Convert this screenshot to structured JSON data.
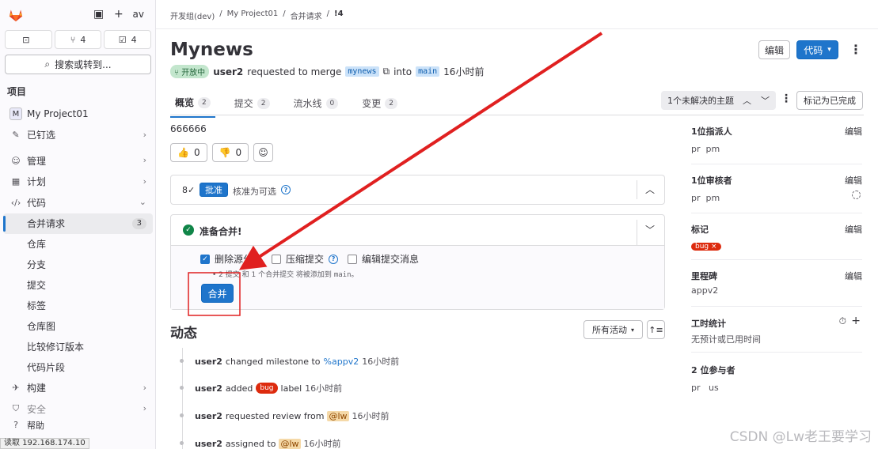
{
  "sidebar": {
    "avatar_text": "av",
    "counts": [
      {
        "icon": "issues-icon",
        "value": ""
      },
      {
        "icon": "merge-request-icon",
        "value": "4"
      },
      {
        "icon": "todo-icon",
        "value": "4"
      }
    ],
    "search_label": "搜索或转到...",
    "section_title": "项目",
    "project": {
      "initial": "M",
      "name": "My Project01"
    },
    "nav": {
      "pinned": "已钉选",
      "manage": "管理",
      "plan": "计划",
      "code": "代码",
      "code_sub": [
        {
          "label": "合并请求",
          "badge": "3"
        },
        {
          "label": "仓库"
        },
        {
          "label": "分支"
        },
        {
          "label": "提交"
        },
        {
          "label": "标签"
        },
        {
          "label": "仓库图"
        },
        {
          "label": "比较修订版本"
        },
        {
          "label": "代码片段"
        }
      ],
      "build": "构建",
      "secure": "安全",
      "help": "帮助"
    }
  },
  "statusbar": {
    "text": "读取 192.168.174.10"
  },
  "breadcrumb": [
    "开发组(dev)",
    "My Project01",
    "合并请求",
    "!4"
  ],
  "header": {
    "title": "Mynews",
    "edit_label": "编辑",
    "code_label": "代码"
  },
  "meta": {
    "state": "开放中",
    "author": "user2",
    "requested": "requested to merge",
    "source_branch": "mynews",
    "into": "into",
    "target_branch": "main",
    "time": "16小时前"
  },
  "tabs": [
    {
      "label": "概览",
      "count": "2"
    },
    {
      "label": "提交",
      "count": "2"
    },
    {
      "label": "流水线",
      "count": "0"
    },
    {
      "label": "变更",
      "count": "2"
    }
  ],
  "threads": {
    "label": "1个未解决的主题",
    "mark_done": "标记为已完成"
  },
  "description": "666666",
  "reactions": {
    "thumbs_up": "0",
    "thumbs_down": "0"
  },
  "approval": {
    "count": "8",
    "approve_label": "批准",
    "optional_text": "核准为可选"
  },
  "merge": {
    "title": "准备合并!",
    "delete_branch": "删除源分支",
    "squash": "压缩提交",
    "edit_message": "编辑提交消息",
    "summary_pre": "• 2 提交 和 1 个合并提交 将被添加到",
    "summary_branch": "main。",
    "merge_button": "合并"
  },
  "activity": {
    "title": "动态",
    "filter": "所有活动",
    "items": [
      {
        "user": "user2",
        "text": "changed milestone to",
        "target": "%appv2",
        "time": "16小时前"
      },
      {
        "user": "user2",
        "text": "added",
        "label": "bug",
        "text2": "label",
        "time": "16小时前"
      },
      {
        "user": "user2",
        "text": "requested review from",
        "mention": "@lw",
        "time": "16小时前"
      },
      {
        "user": "user2",
        "text": "assigned to",
        "mention": "@lw",
        "time": "16小时前"
      }
    ]
  },
  "right_panel": {
    "edit_label": "编辑",
    "assignees": {
      "title": "1位指派人",
      "avatar": "pr",
      "name": "pm"
    },
    "reviewers": {
      "title": "1位审核者",
      "avatar": "pr",
      "name": "pm"
    },
    "labels": {
      "title": "标记",
      "label": "bug"
    },
    "milestone": {
      "title": "里程碑",
      "value": "appv2"
    },
    "time_tracking": {
      "title": "工时统计",
      "value": "无预计或已用时间"
    },
    "participants": {
      "title": "2 位参与者",
      "avatars": [
        "pr",
        "us"
      ]
    }
  },
  "watermark": "CSDN @Lw老王要学习",
  "colors": {
    "primary": "#1f75cb",
    "success": "#108548",
    "danger": "#dd2b0e",
    "annotation": "#e02020"
  }
}
